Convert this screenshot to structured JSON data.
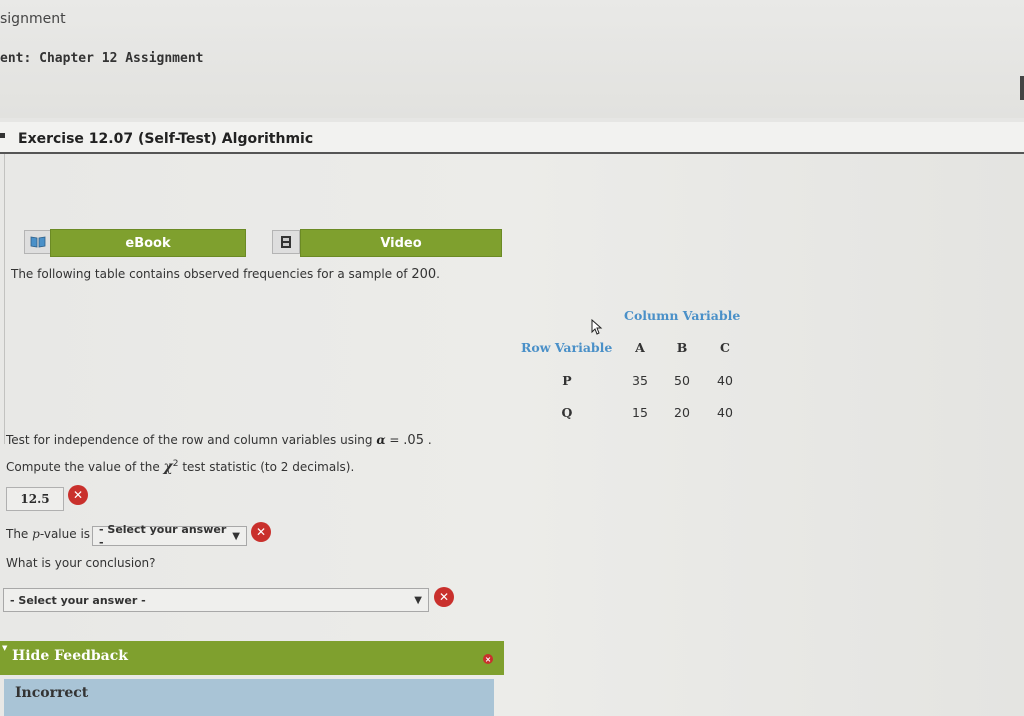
{
  "header": {
    "breadcrumb": "signment",
    "assignment_title": "ent: Chapter 12 Assignment"
  },
  "exercise": {
    "title": "Exercise 12.07 (Self-Test) Algorithmic"
  },
  "resources": {
    "ebook_label": "eBook",
    "video_label": "Video"
  },
  "intro": {
    "text": "The following table contains observed frequencies for a sample of",
    "sample_size": "200",
    "period": "."
  },
  "table": {
    "column_header": "Column Variable",
    "row_header": "Row Variable",
    "columns": [
      "A",
      "B",
      "C"
    ],
    "rows": [
      {
        "label": "P",
        "values": [
          "35",
          "50",
          "40"
        ]
      },
      {
        "label": "Q",
        "values": [
          "15",
          "20",
          "40"
        ]
      }
    ]
  },
  "questions": {
    "test_prompt": "Test for independence of the row and column variables using",
    "alpha_symbol": "α",
    "alpha_equals": "=",
    "alpha_value": ".05",
    "alpha_period": ".",
    "compute_prompt_before": "Compute the value of the",
    "chi_symbol": "χ",
    "chi_power": "2",
    "compute_prompt_after": "test statistic (to 2 decimals).",
    "chi_answer": "12.5",
    "pvalue_prefix": "The",
    "pvalue_italic": "p",
    "pvalue_suffix": "-value is",
    "pvalue_select": "- Select your answer -",
    "conclusion_prompt": "What is your conclusion?",
    "conclusion_select": "- Select your answer -"
  },
  "feedback": {
    "toggle_label": "Hide Feedback",
    "status": "Incorrect"
  },
  "colors": {
    "accent_green": "#7fa02e",
    "table_header_blue": "#4a90c8",
    "error_red": "#c9302c",
    "feedback_blue": "#a9c4d6"
  },
  "icons": {
    "ebook": "book-icon",
    "video": "film-icon",
    "incorrect": "x-circle-icon",
    "cursor": "mouse-cursor-icon"
  }
}
